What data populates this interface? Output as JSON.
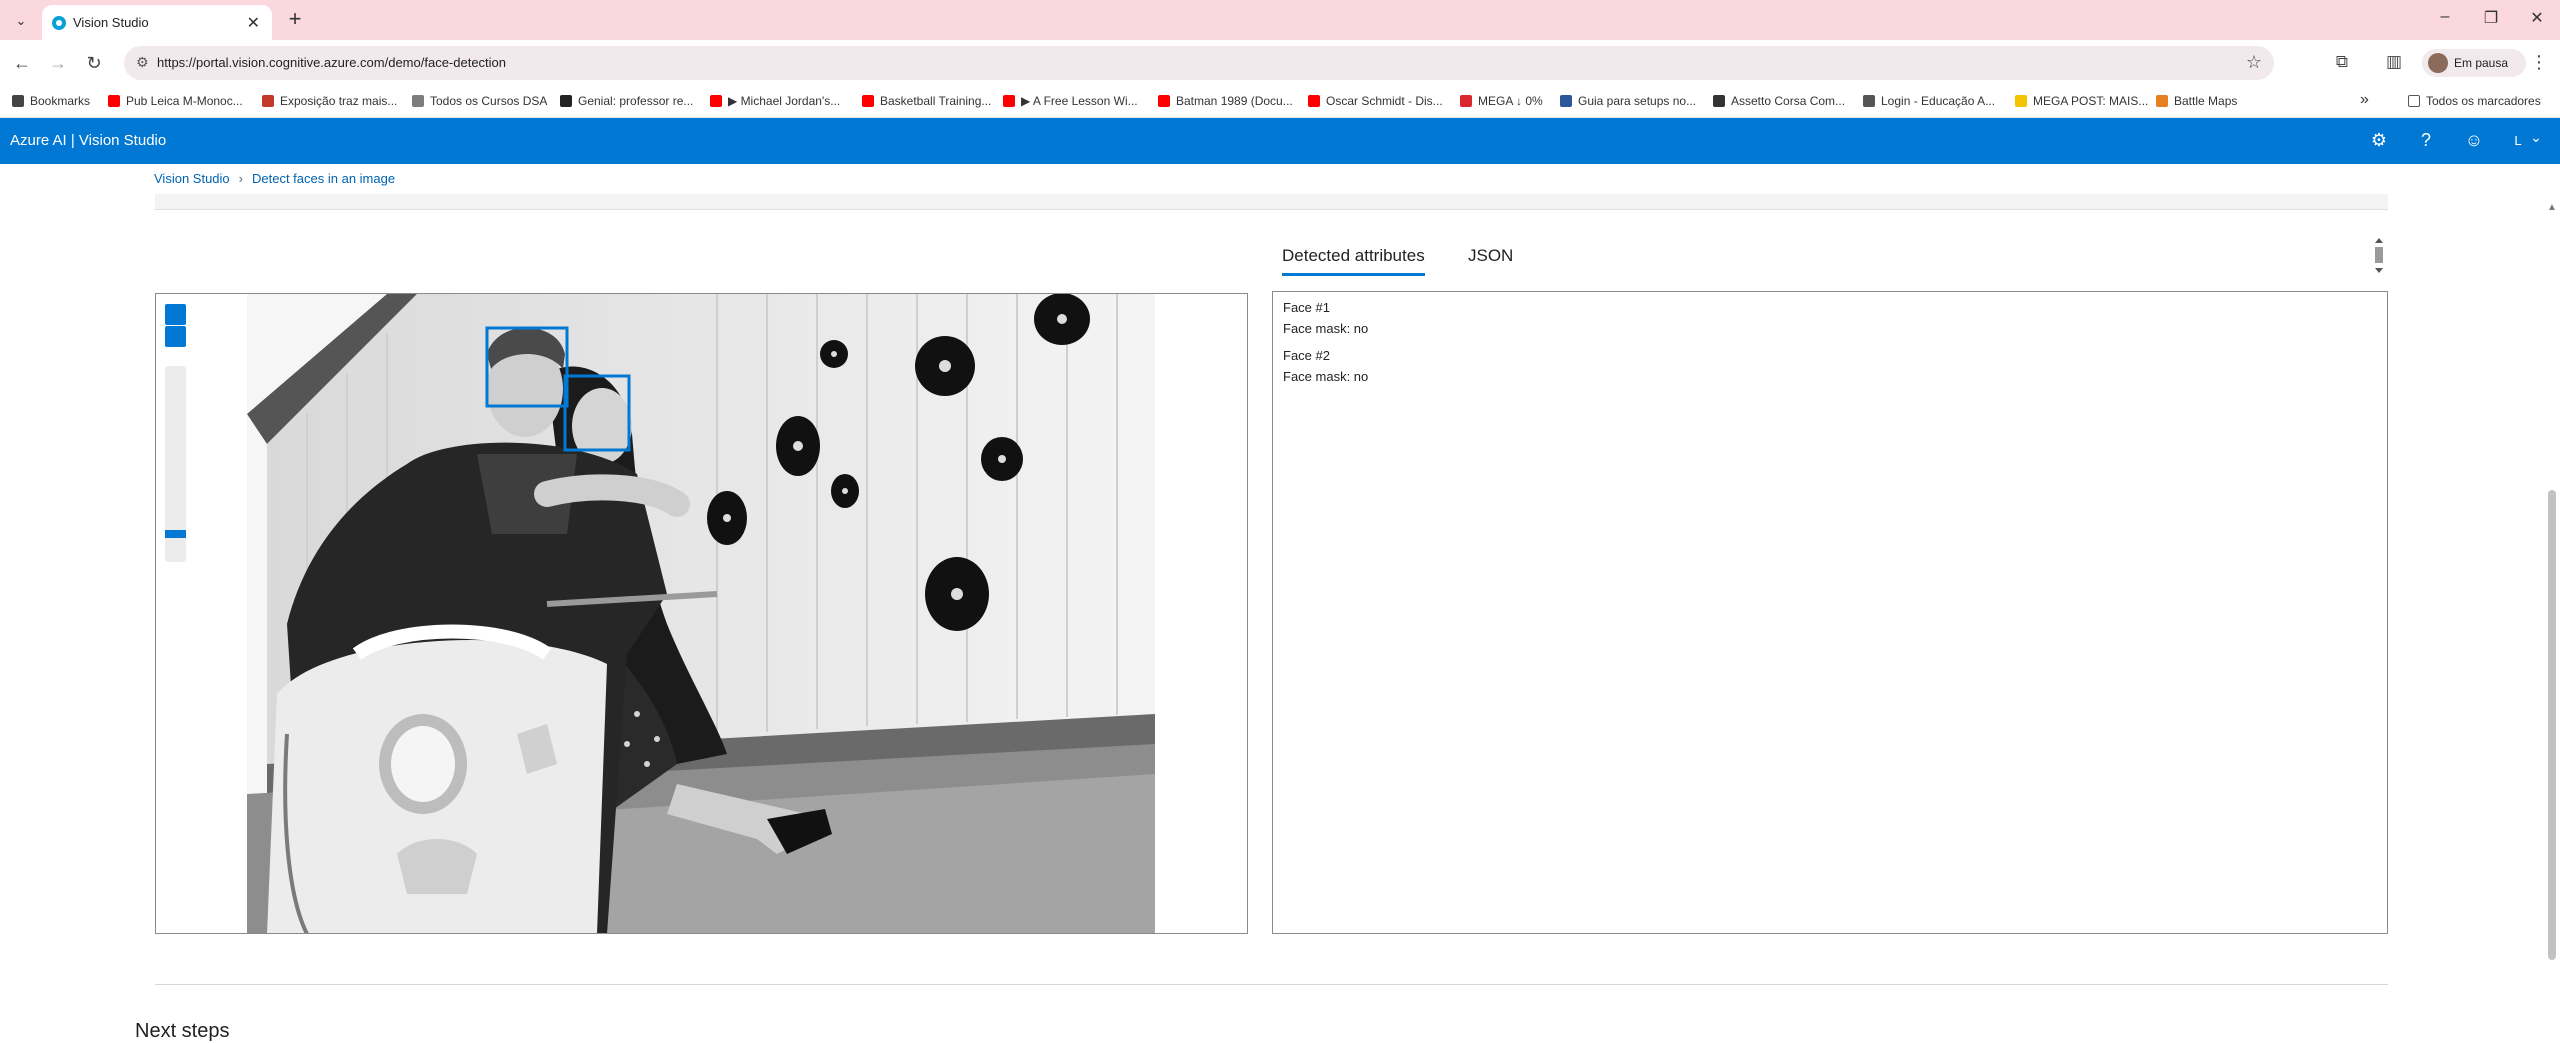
{
  "browser": {
    "tab_title": "Vision Studio",
    "tab_close": "✕",
    "new_tab": "+",
    "tab_dropdown": "⌄",
    "url": "https://portal.vision.cognitive.azure.com/demo/face-detection",
    "profile_label": "Em pausa",
    "window": {
      "minimize": "–",
      "restore": "❐",
      "close": "✕"
    }
  },
  "bookmarks": {
    "items": [
      {
        "label": "Bookmarks",
        "icon": "star-icon",
        "color": "#444444"
      },
      {
        "label": "Pub Leica M-Monoc...",
        "icon": "youtube-icon",
        "color": "#ff0000"
      },
      {
        "label": "Exposição traz mais...",
        "icon": "site-icon",
        "color": "#c0392b"
      },
      {
        "label": "Todos os Cursos DSA",
        "icon": "site-icon",
        "color": "#7d7d7d"
      },
      {
        "label": "Genial: professor re...",
        "icon": "site-icon",
        "color": "#222222"
      },
      {
        "label": "▶ Michael Jordan's...",
        "icon": "youtube-icon",
        "color": "#ff0000"
      },
      {
        "label": "Basketball Training...",
        "icon": "youtube-icon",
        "color": "#ff0000"
      },
      {
        "label": "▶ A Free Lesson Wi...",
        "icon": "youtube-icon",
        "color": "#ff0000"
      },
      {
        "label": "Batman 1989 (Docu...",
        "icon": "youtube-icon",
        "color": "#ff0000"
      },
      {
        "label": "Oscar Schmidt - Dis...",
        "icon": "youtube-icon",
        "color": "#ff0000"
      },
      {
        "label": "MEGA ↓ 0%",
        "icon": "mega-icon",
        "color": "#d9272e"
      },
      {
        "label": "Guia para setups no...",
        "icon": "word-icon",
        "color": "#2b579a"
      },
      {
        "label": "Assetto Corsa Com...",
        "icon": "site-icon",
        "color": "#333333"
      },
      {
        "label": "Login - Educação A...",
        "icon": "site-icon",
        "color": "#555555"
      },
      {
        "label": "MEGA POST: MAIS...",
        "icon": "smiley-icon",
        "color": "#f2c500"
      },
      {
        "label": "Battle Maps",
        "icon": "site-icon",
        "color": "#e67e22"
      }
    ],
    "more": "»",
    "all_bookmarks": "Todos os marcadores"
  },
  "azure": {
    "title": "Azure AI  |  Vision Studio",
    "settings_icon": "⚙",
    "help_icon": "?",
    "feedback_icon": "☺",
    "account_initial": "L",
    "account_chevron": "⌄",
    "accent": "#0078d4"
  },
  "breadcrumb": {
    "root": "Vision Studio",
    "separator": "›",
    "current": "Detect faces in an image"
  },
  "results": {
    "tabs": [
      {
        "label": "Detected attributes",
        "active": true
      },
      {
        "label": "JSON",
        "active": false
      }
    ],
    "faces": [
      {
        "heading": "Face #1",
        "mask": "Face mask: no"
      },
      {
        "heading": "Face #2",
        "mask": "Face mask: no"
      }
    ]
  },
  "next_steps": "Next steps"
}
